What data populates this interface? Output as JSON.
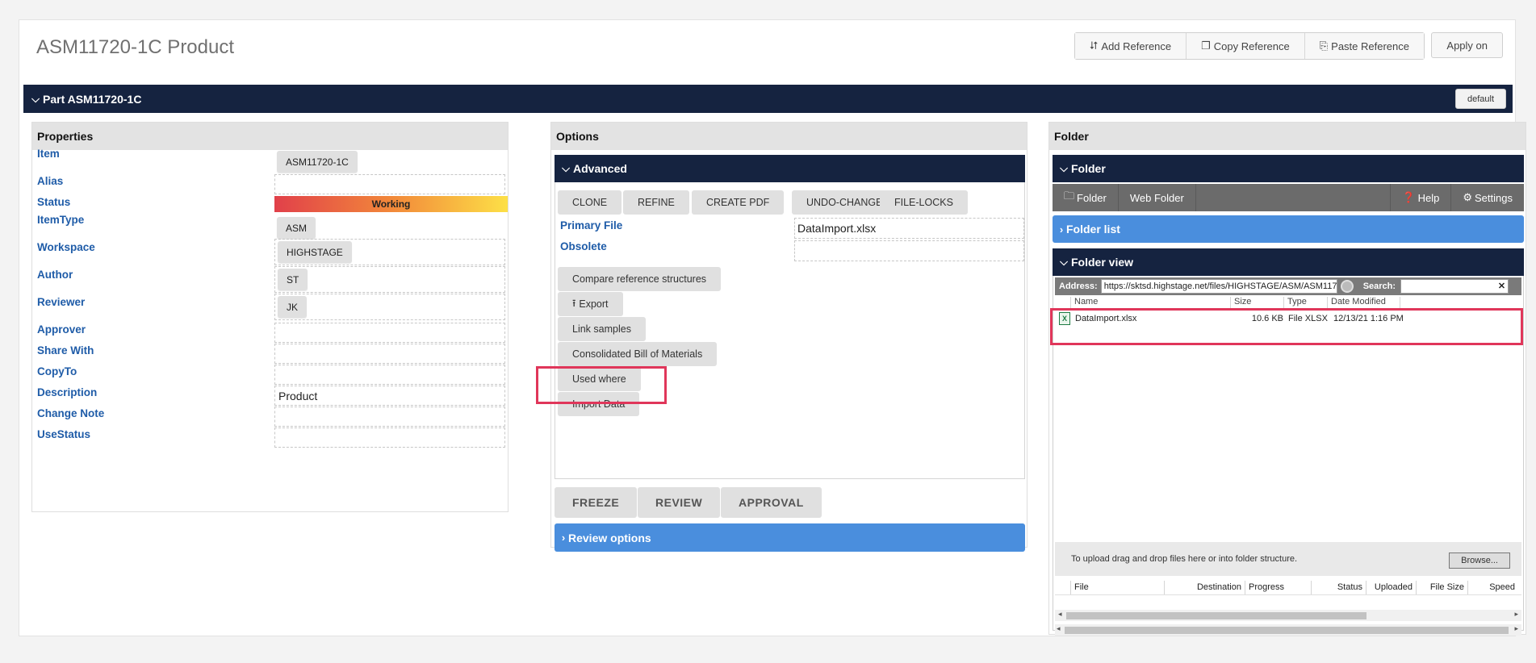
{
  "page": {
    "title": "ASM11720-1C Product"
  },
  "toolbar": {
    "add_reference": "Add Reference",
    "copy_reference": "Copy Reference",
    "paste_reference": "Paste Reference",
    "apply_on": "Apply on"
  },
  "part": {
    "header": "Part ASM11720-1C",
    "default_label": "default"
  },
  "properties": {
    "title": "Properties",
    "item_label": "Item",
    "item_value": "ASM11720-1C",
    "alias_label": "Alias",
    "status_label": "Status",
    "status_value": "Working",
    "itemtype_label": "ItemType",
    "itemtype_value": "ASM",
    "workspace_label": "Workspace",
    "workspace_value": "HIGHSTAGE",
    "author_label": "Author",
    "author_value": "ST",
    "reviewer_label": "Reviewer",
    "reviewer_value": "JK",
    "approver_label": "Approver",
    "sharewith_label": "Share With",
    "copyto_label": "CopyTo",
    "description_label": "Description",
    "description_value": "Product",
    "changenote_label": "Change Note",
    "usestatus_label": "UseStatus"
  },
  "options": {
    "title": "Options",
    "advanced": "Advanced",
    "clone": "CLONE",
    "refine": "REFINE",
    "create_pdf": "CREATE PDF",
    "undo_change": "UNDO-CHANGE",
    "file_locks": "FILE-LOCKS",
    "primary_file_label": "Primary File",
    "primary_file_value": "DataImport.xlsx",
    "obsolete_label": "Obsolete",
    "compare": "Compare reference structures",
    "export": "Export",
    "link_samples": "Link samples",
    "consolidated_bom": "Consolidated Bill of Materials",
    "used_where": "Used where",
    "import_data": "Import Data",
    "freeze": "FREEZE",
    "review": "REVIEW",
    "approval": "APPROVAL",
    "review_options": "Review options"
  },
  "folder": {
    "title": "Folder",
    "folder_head": "Folder",
    "tb_folder": "Folder",
    "tb_web_folder": "Web Folder",
    "tb_help": "Help",
    "tb_settings": "Settings",
    "folder_list": "Folder list",
    "folder_view": "Folder view",
    "address_label": "Address:",
    "address_value": "https://sktsd.highstage.net/files/HIGHSTAGE/ASM/ASM117",
    "search_label": "Search:",
    "col_name": "Name",
    "col_size": "Size",
    "col_type": "Type",
    "col_modified": "Date Modified",
    "file": {
      "name": "DataImport.xlsx",
      "size": "10.6 KB",
      "type": "File XLSX",
      "modified": "12/13/21 1:16 PM",
      "icon": "excel-file-icon"
    },
    "upload_hint": "To upload drag and drop files here or into folder structure.",
    "browse": "Browse...",
    "up_file": "File",
    "up_destination": "Destination",
    "up_progress": "Progress",
    "up_status": "Status",
    "up_uploaded": "Uploaded",
    "up_filesize": "File Size",
    "up_speed": "Speed"
  },
  "colors": {
    "navy": "#152340",
    "blue": "#4a8edd",
    "label_blue": "#1f5ca8",
    "highlight": "#e0365a"
  }
}
